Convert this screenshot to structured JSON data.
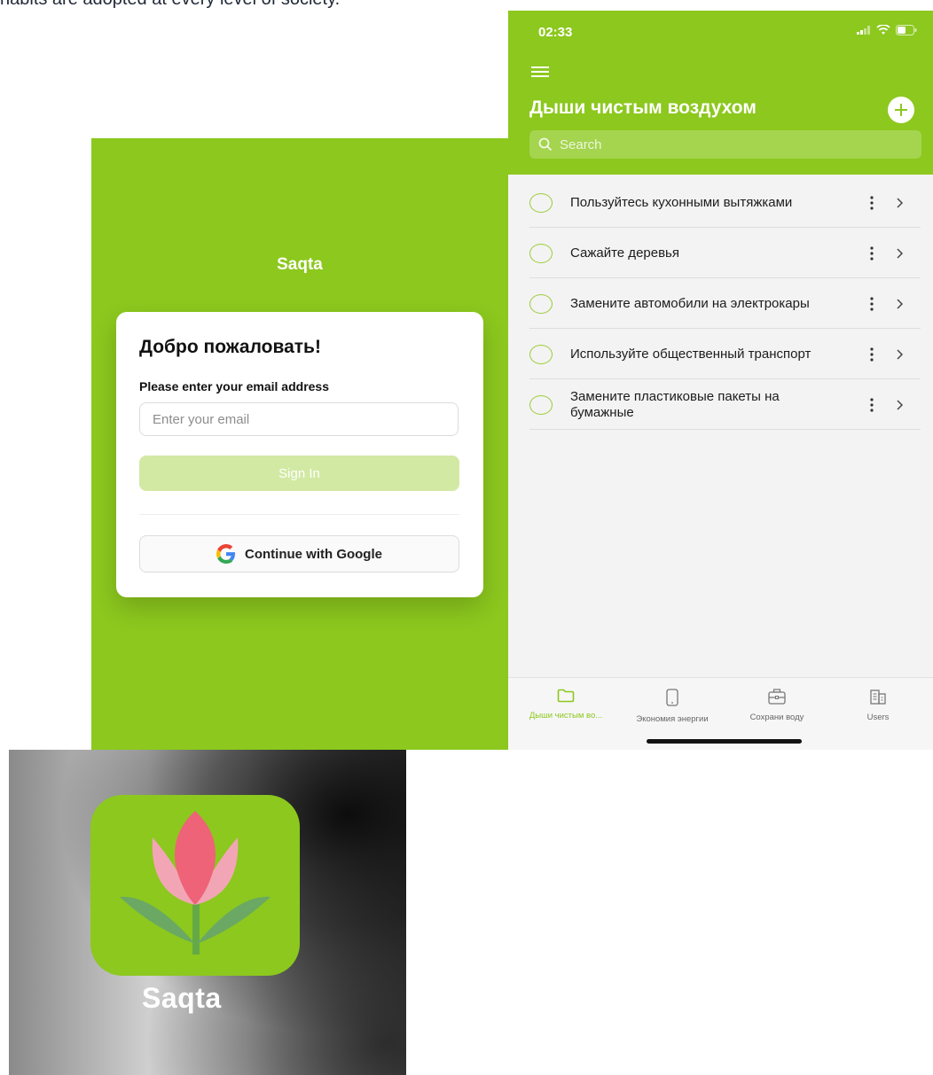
{
  "document": {
    "caption_fragment": "habits are adopted at every level of society."
  },
  "login_screen": {
    "app_name": "Saqta",
    "welcome_title": "Добро пожаловать!",
    "email_label": "Please enter your email address",
    "email_placeholder": "Enter your email",
    "sign_in_label": "Sign In",
    "google_button_label": "Continue with Google",
    "colors": {
      "brand_green": "#8cc81e",
      "sign_in_disabled": "#d2e9a3"
    }
  },
  "list_screen": {
    "status_time": "02:33",
    "title": "Дыши чистым воздухом",
    "search_placeholder": "Search",
    "items": [
      {
        "text": "Пользуйтесь кухонными вытяжками"
      },
      {
        "text": "Сажайте деревья"
      },
      {
        "text": "Замените автомобили на электрокары"
      },
      {
        "text": "Используйте общественный транспорт"
      },
      {
        "text": "Замените пластиковые пакеты на бумажные"
      }
    ],
    "tabs": [
      {
        "label": "Дыши чистым во...",
        "icon": "folder-icon",
        "active": true
      },
      {
        "label": "Экономия энергии",
        "icon": "phone-icon",
        "active": false
      },
      {
        "label": "Сохрани воду",
        "icon": "briefcase-icon",
        "active": false
      },
      {
        "label": "Users",
        "icon": "building-icon",
        "active": false
      }
    ]
  },
  "app_icon": {
    "label": "Saqta",
    "icon": "tulip-icon"
  }
}
